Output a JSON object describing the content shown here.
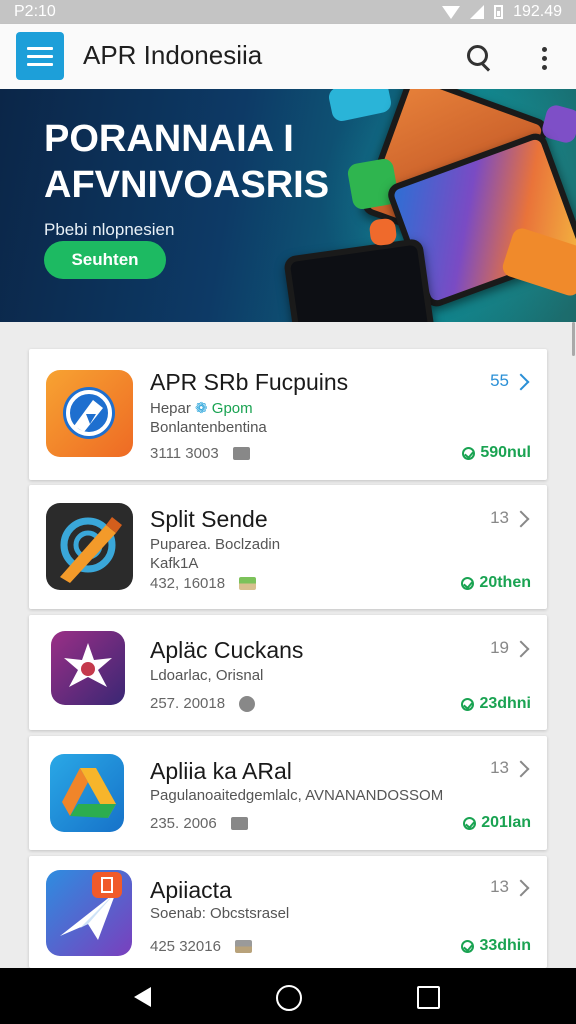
{
  "status_bar": {
    "time": "P2:10",
    "right_text": "192.49"
  },
  "app_bar": {
    "title": "APR Indonesiia"
  },
  "banner": {
    "headline_line1": "PORANNAIA I",
    "headline_line2": "AFVNIVOASRIS",
    "subtitle": "Pbebi nlopnesien",
    "button_label": "Seuhten"
  },
  "apps": [
    {
      "name": "APR SRb Fucpuins",
      "line1_a": "Hepar",
      "line1_b": "Gpom",
      "line2": "Bonlantenbentina",
      "meta": "3111 3003",
      "badge": "55",
      "status": "590nul"
    },
    {
      "name": "Split Sende",
      "line1": "Puparea. Boclzadin",
      "line2": "Kafk1A",
      "meta": "432, 16018",
      "badge": "13",
      "status": "20then"
    },
    {
      "name": "Apläc Cuckans",
      "line1": "Ldoarlac, Orisnal",
      "meta": "257. 20018",
      "badge": "19",
      "status": "23dhni"
    },
    {
      "name": "Apliia ka ARal",
      "line1": "Pagulanoaitedgemlalc, AVNANANDOSSOM",
      "meta": "235. 2006",
      "badge": "13",
      "status": "201lan"
    },
    {
      "name": "Apiiacta",
      "line1": "Soenab: Obcstsrasel",
      "meta": "425 32016",
      "badge": "13",
      "status": "33dhin"
    }
  ],
  "colors": {
    "accent": "#1d9fd9",
    "green": "#1dba62",
    "status_green": "#1aa352"
  }
}
